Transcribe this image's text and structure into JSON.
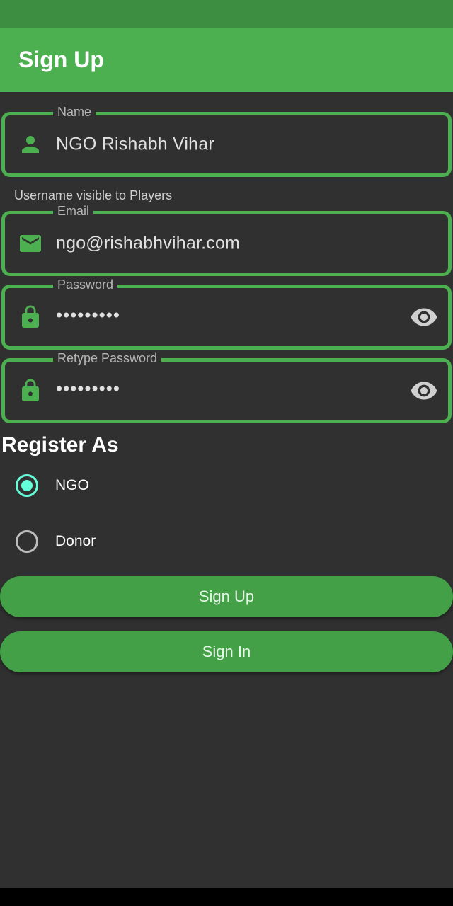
{
  "app_bar": {
    "title": "Sign Up"
  },
  "form": {
    "name": {
      "label": "Name",
      "value": "NGO Rishabh Vihar",
      "icon": "person-icon"
    },
    "helper_text": "Username visible to Players",
    "email": {
      "label": "Email",
      "value": "ngo@rishabhvihar.com",
      "icon": "mail-icon"
    },
    "password": {
      "label": "Password",
      "value": "•••••••••",
      "icon": "lock-icon"
    },
    "retype_password": {
      "label": "Retype Password",
      "value": "•••••••••",
      "icon": "lock-icon"
    }
  },
  "register_as": {
    "title": "Register As",
    "options": [
      {
        "label": "NGO",
        "selected": true
      },
      {
        "label": "Donor",
        "selected": false
      }
    ]
  },
  "buttons": {
    "sign_up": "Sign Up",
    "sign_in": "Sign In"
  },
  "colors": {
    "accent": "#4caf50",
    "app_bar": "#4caf50",
    "status_bar": "#3e8e41",
    "background": "#303030",
    "radio_selected": "#64ffda"
  }
}
